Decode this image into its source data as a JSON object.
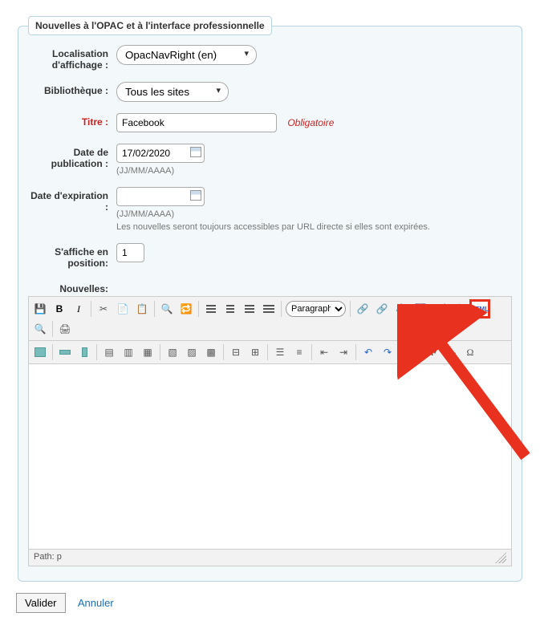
{
  "legend": "Nouvelles à l'OPAC et à l'interface professionnelle",
  "labels": {
    "location": "Localisation d'affichage :",
    "library": "Bibliothèque :",
    "title": "Titre :",
    "pubdate": "Date de publication :",
    "expdate": "Date d'expiration :",
    "position": "S'affiche en position:",
    "news": "Nouvelles:"
  },
  "values": {
    "location": "OpacNavRight (en)",
    "library": "Tous les sites",
    "title": "Facebook",
    "pubdate": "17/02/2020",
    "expdate": "",
    "position": "1"
  },
  "hints": {
    "required": "Obligatoire",
    "datefmt": "(JJ/MM/AAAA)",
    "expnote": "Les nouvelles seront toujours accessibles par URL directe si elles sont expirées."
  },
  "editor": {
    "paragraph": "Paragraph",
    "path_label": "Path:",
    "path_value": "p"
  },
  "actions": {
    "submit": "Valider",
    "cancel": "Annuler"
  }
}
